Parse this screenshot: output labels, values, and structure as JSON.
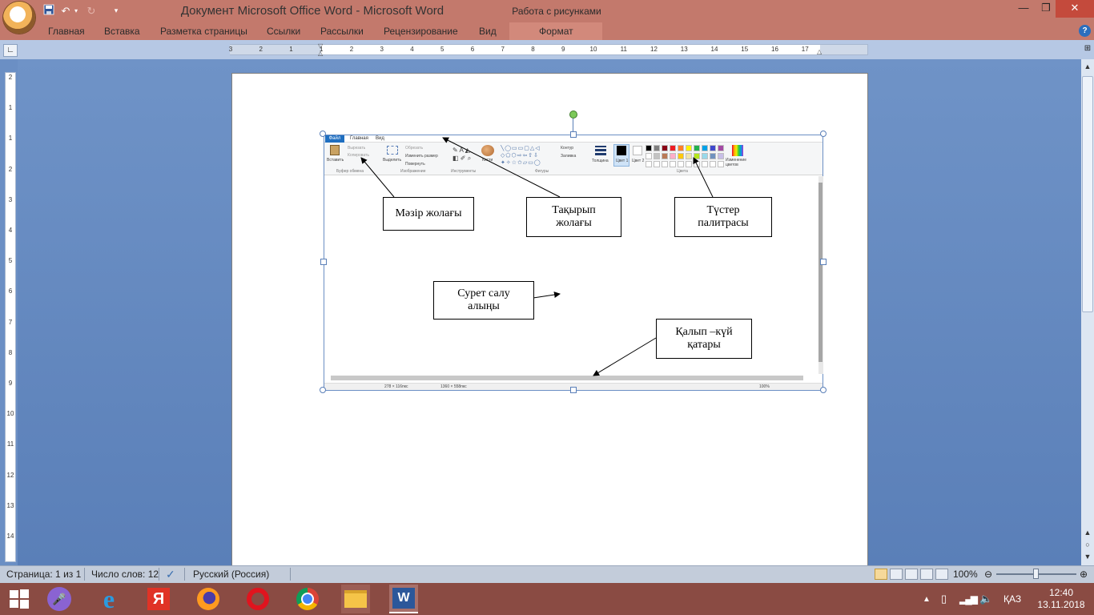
{
  "window": {
    "title": "Документ Microsoft Office Word  -  Microsoft Word",
    "context_title": "Работа с рисунками"
  },
  "quick_access": {
    "save_icon": "save-icon",
    "undo_icon": "undo-icon",
    "redo_icon": "redo-icon"
  },
  "ribbon": {
    "tabs": [
      "Главная",
      "Вставка",
      "Разметка страницы",
      "Ссылки",
      "Рассылки",
      "Рецензирование",
      "Вид"
    ],
    "context_tab": "Формат"
  },
  "ruler": {
    "h_ticks": [
      "3",
      "2",
      "1",
      "1",
      "2",
      "3",
      "4",
      "5",
      "6",
      "7",
      "8",
      "9",
      "10",
      "11",
      "12",
      "13",
      "14",
      "15",
      "16",
      "17"
    ],
    "v_ticks": [
      "2",
      "1",
      "1",
      "2",
      "3",
      "4",
      "5",
      "6",
      "7",
      "8",
      "9",
      "10",
      "11",
      "12",
      "13",
      "14"
    ]
  },
  "paint": {
    "tabs": [
      "Файл",
      "Главная",
      "Вид"
    ],
    "clipboard": {
      "paste": "Вставить",
      "cut": "Вырезать",
      "copy": "Копировать",
      "group": "Буфер обмена"
    },
    "image": {
      "select": "Выделить",
      "crop": "Обрезать",
      "resize": "Изменить размер",
      "rotate": "Повернуть",
      "group": "Изображение"
    },
    "tools": {
      "group": "Инструменты",
      "brush": "Кисти"
    },
    "shapes": {
      "group": "Фигуры",
      "outline": "Контур",
      "fill": "Заливка"
    },
    "size_label": "Толщина",
    "color1": "Цвет 1",
    "color2": "Цвет 2",
    "colors_group": "Цвета",
    "edit_colors": "Изменение цветов",
    "palette": [
      "#000000",
      "#7f7f7f",
      "#880015",
      "#ed1c24",
      "#ff7f27",
      "#fff200",
      "#22b14c",
      "#00a2e8",
      "#3f48cc",
      "#a349a4",
      "#ffffff",
      "#c3c3c3",
      "#b97a57",
      "#ffaec9",
      "#ffc90e",
      "#efe4b0",
      "#b5e61d",
      "#99d9ea",
      "#7092be",
      "#c8bfe7"
    ],
    "status": {
      "cursor": "278 × 116пкс",
      "size": "1360 × 558пкс",
      "zoom": "100%"
    }
  },
  "callouts": {
    "menu": "Мәзір жолағы",
    "title_bar": "Тақырып жолағы",
    "palette": "Түстер палитрасы",
    "canvas": "Сурет салу алыңы",
    "status": "Қалып –күй қатары"
  },
  "statusbar": {
    "page": "Страница: 1 из 1",
    "words": "Число слов: 12",
    "language": "Русский (Россия)",
    "zoom": "100%"
  },
  "taskbar": {
    "apps": [
      "start-icon",
      "cortana-icon",
      "internet-explorer-icon",
      "yandex-icon",
      "firefox-icon",
      "opera-icon",
      "chrome-icon",
      "file-explorer-icon",
      "word-icon"
    ],
    "lang": "ҚАЗ",
    "time": "12:40",
    "date": "13.11.2018"
  }
}
